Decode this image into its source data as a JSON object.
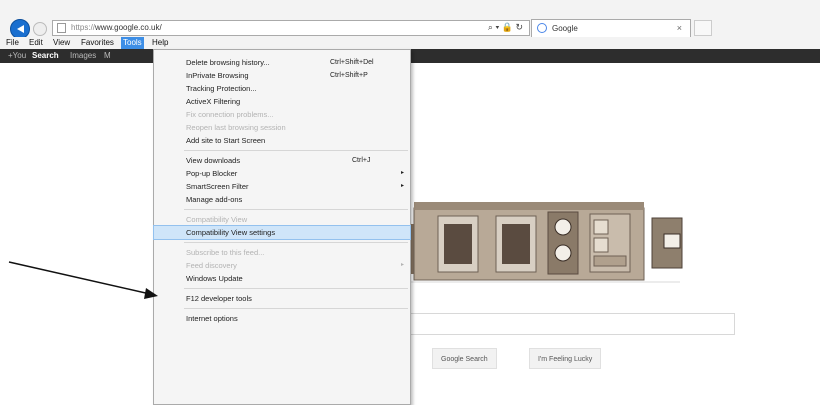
{
  "browser": {
    "url_protocol": "https://",
    "url_host": "www.google.co.uk/",
    "address_icons": "⌕ ▾ 🔒 ↻",
    "tab_title": "Google",
    "tab_close": "×"
  },
  "menubar": {
    "items": [
      "File",
      "Edit",
      "View",
      "Favorites",
      "Tools",
      "Help"
    ],
    "active": "Tools"
  },
  "google_bar": {
    "links": [
      "+You",
      "Search",
      "Images",
      "M"
    ],
    "active": "Search"
  },
  "tools_menu": {
    "items": [
      {
        "label": "Delete browsing history...",
        "shortcut": "Ctrl+Shift+Del",
        "enabled": true
      },
      {
        "label": "InPrivate Browsing",
        "shortcut": "Ctrl+Shift+P",
        "enabled": true
      },
      {
        "label": "Tracking Protection...",
        "enabled": true
      },
      {
        "label": "ActiveX Filtering",
        "enabled": true
      },
      {
        "label": "Fix connection problems...",
        "enabled": false
      },
      {
        "label": "Reopen last browsing session",
        "enabled": false
      },
      {
        "label": "Add site to Start Screen",
        "enabled": true
      },
      {
        "label": "View downloads",
        "shortcut": "Ctrl+J",
        "enabled": true
      },
      {
        "label": "Pop-up Blocker",
        "submenu": true,
        "enabled": true
      },
      {
        "label": "SmartScreen Filter",
        "submenu": true,
        "enabled": true
      },
      {
        "label": "Manage add-ons",
        "enabled": true
      },
      {
        "label": "Compatibility View",
        "enabled": false
      },
      {
        "label": "Compatibility View settings",
        "enabled": true,
        "highlighted": true
      },
      {
        "label": "Subscribe to this feed...",
        "enabled": false
      },
      {
        "label": "Feed discovery",
        "submenu": true,
        "enabled": false
      },
      {
        "label": "Windows Update",
        "enabled": true
      },
      {
        "label": "F12 developer tools",
        "enabled": true
      },
      {
        "label": "Internet options",
        "enabled": true
      }
    ],
    "submenu_arrow": "▸"
  },
  "google": {
    "search_button": "Google Search",
    "lucky_button": "I'm Feeling Lucky"
  },
  "colors": {
    "menu_highlight": "#cfe5f9",
    "active_menu": "#3d8ee6",
    "google_bar": "#2d2d2d"
  }
}
